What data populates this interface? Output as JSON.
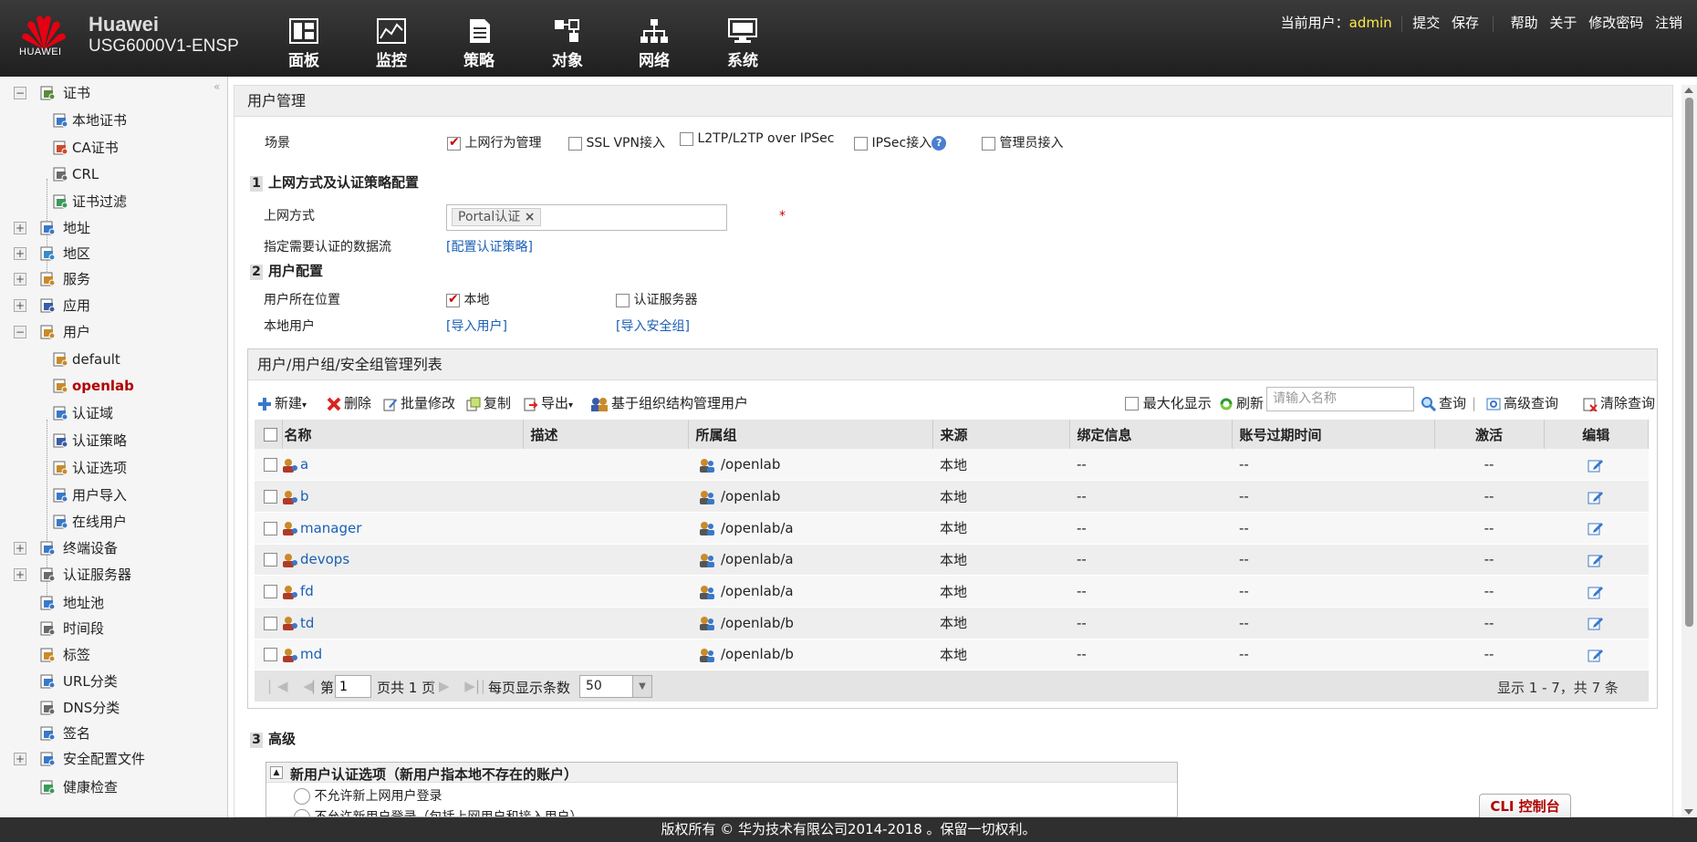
{
  "header": {
    "logo_text": "HUAWEI",
    "brand_name": "Huawei",
    "device_model": "USG6000V1-ENSP",
    "nav": [
      {
        "label": "面板",
        "icon": "dashboard-icon"
      },
      {
        "label": "监控",
        "icon": "monitor-icon"
      },
      {
        "label": "策略",
        "icon": "policy-icon"
      },
      {
        "label": "对象",
        "icon": "object-icon"
      },
      {
        "label": "网络",
        "icon": "network-icon"
      },
      {
        "label": "系统",
        "icon": "system-icon"
      }
    ],
    "current_user_label": "当前用户：",
    "current_user": "admin",
    "links": {
      "submit": "提交",
      "save": "保存",
      "help": "帮助",
      "about": "关于",
      "change_password": "修改密码",
      "logout": "注销"
    }
  },
  "sidebar": {
    "items": [
      {
        "label": "证书",
        "toggle": "−",
        "icon": "certificate-icon"
      },
      {
        "label": "本地证书",
        "icon": "local-cert-icon",
        "child": true
      },
      {
        "label": "CA证书",
        "icon": "ca-cert-icon",
        "child": true
      },
      {
        "label": "CRL",
        "icon": "crl-icon",
        "child": true
      },
      {
        "label": "证书过滤",
        "icon": "cert-filter-icon",
        "child": true
      },
      {
        "label": "地址",
        "toggle": "+",
        "icon": "address-icon"
      },
      {
        "label": "地区",
        "toggle": "+",
        "icon": "region-icon"
      },
      {
        "label": "服务",
        "toggle": "+",
        "icon": "service-icon"
      },
      {
        "label": "应用",
        "toggle": "+",
        "icon": "application-icon"
      },
      {
        "label": "用户",
        "toggle": "−",
        "icon": "user-icon"
      },
      {
        "label": "default",
        "icon": "user-group-icon",
        "child": true
      },
      {
        "label": "openlab",
        "icon": "user-group-icon",
        "child": true,
        "selected": true
      },
      {
        "label": "认证域",
        "icon": "auth-domain-icon",
        "child": true
      },
      {
        "label": "认证策略",
        "icon": "auth-policy-icon",
        "child": true
      },
      {
        "label": "认证选项",
        "icon": "auth-option-icon",
        "child": true
      },
      {
        "label": "用户导入",
        "icon": "user-import-icon",
        "child": true
      },
      {
        "label": "在线用户",
        "icon": "online-user-icon",
        "child": true
      },
      {
        "label": "终端设备",
        "toggle": "+",
        "icon": "terminal-device-icon"
      },
      {
        "label": "认证服务器",
        "toggle": "+",
        "icon": "auth-server-icon"
      },
      {
        "label": "地址池",
        "icon": "address-pool-icon"
      },
      {
        "label": "时间段",
        "icon": "time-range-icon"
      },
      {
        "label": "标签",
        "icon": "tag-icon"
      },
      {
        "label": "URL分类",
        "icon": "url-category-icon"
      },
      {
        "label": "DNS分类",
        "icon": "dns-category-icon"
      },
      {
        "label": "签名",
        "icon": "signature-icon"
      },
      {
        "label": "安全配置文件",
        "toggle": "+",
        "icon": "security-profile-icon"
      },
      {
        "label": "健康检查",
        "icon": "health-check-icon"
      }
    ]
  },
  "main": {
    "title": "用户管理",
    "scene_label": "场景",
    "scenes": [
      {
        "label": "上网行为管理",
        "checked": true
      },
      {
        "label": "SSL VPN接入",
        "checked": false
      },
      {
        "label": "L2TP/L2TP over IPSec",
        "checked": false
      },
      {
        "label": "IPSec接入",
        "checked": false
      },
      {
        "label": "管理员接入",
        "checked": false
      }
    ],
    "section1": {
      "num": "1",
      "title": "上网方式及认证策略配置",
      "access_mode_label": "上网方式",
      "access_mode_tag": "Portal认证",
      "tag_remove": "×",
      "required": "*",
      "flow_label": "指定需要认证的数据流",
      "flow_link": "[配置认证策略]"
    },
    "section2": {
      "num": "2",
      "title": "用户配置",
      "location_label": "用户所在位置",
      "local_option": "本地",
      "server_option": "认证服务器",
      "local_user_label": "本地用户",
      "import_user_link": "[导入用户]",
      "import_group_link": "[导入安全组]"
    },
    "section3": {
      "num": "3",
      "title": "高级",
      "box_title": "新用户认证选项（新用户指本地不存在的账户）",
      "collapse": "▲",
      "opt1": "不允许新上网用户登录",
      "opt2": "不允许新用户登录（包括上网用户和接入用户）"
    }
  },
  "user_list": {
    "title": "用户/用户组/安全组管理列表",
    "toolbar": {
      "new": "新建",
      "delete": "删除",
      "batch_edit": "批量修改",
      "copy": "复制",
      "export": "导出",
      "org_manage": "基于组织结构管理用户",
      "maximize": "最大化显示",
      "refresh": "刷新",
      "search_placeholder": "请输入名称",
      "query": "查询",
      "advanced_query": "高级查询",
      "clear_query": "清除查询"
    },
    "columns": [
      "名称",
      "描述",
      "所属组",
      "来源",
      "绑定信息",
      "账号过期时间",
      "激活",
      "编辑"
    ],
    "rows": [
      {
        "name": "a",
        "desc": "",
        "group": "/openlab",
        "source": "本地",
        "bind": "--",
        "expire": "--",
        "active": "--"
      },
      {
        "name": "b",
        "desc": "",
        "group": "/openlab",
        "source": "本地",
        "bind": "--",
        "expire": "--",
        "active": "--"
      },
      {
        "name": "manager",
        "desc": "",
        "group": "/openlab/a",
        "source": "本地",
        "bind": "--",
        "expire": "--",
        "active": "--"
      },
      {
        "name": "devops",
        "desc": "",
        "group": "/openlab/a",
        "source": "本地",
        "bind": "--",
        "expire": "--",
        "active": "--"
      },
      {
        "name": "fd",
        "desc": "",
        "group": "/openlab/a",
        "source": "本地",
        "bind": "--",
        "expire": "--",
        "active": "--"
      },
      {
        "name": "td",
        "desc": "",
        "group": "/openlab/b",
        "source": "本地",
        "bind": "--",
        "expire": "--",
        "active": "--"
      },
      {
        "name": "md",
        "desc": "",
        "group": "/openlab/b",
        "source": "本地",
        "bind": "--",
        "expire": "--",
        "active": "--"
      }
    ],
    "pager": {
      "page_prefix": "第",
      "page": "1",
      "page_suffix": "页共 1 页",
      "per_page_label": "每页显示条数",
      "per_page": "50",
      "summary": "显示 1 - 7，共 7 条"
    }
  },
  "cli_label": "CLI 控制台",
  "footer": "版权所有 © 华为技术有限公司2014-2018 。保留一切权利。",
  "colors": {
    "header_bg": "#2a2a2a",
    "accent_red": "#b10000",
    "link_blue": "#1a5fb4",
    "user_highlight": "#ffe94a"
  }
}
